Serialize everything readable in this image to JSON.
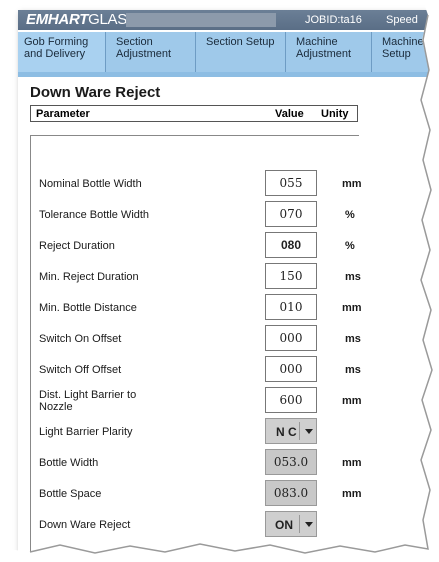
{
  "header": {
    "brand_bold": "EMHART",
    "brand_light": "GLASS",
    "jobid": "JOBID:ta16",
    "speed": "Speed"
  },
  "tabs": [
    {
      "label": "Gob Forming and Delivery"
    },
    {
      "label": "Section Adjustment"
    },
    {
      "label": "Section Setup"
    },
    {
      "label": "Machine Adjustment"
    },
    {
      "label": "Machine Setup"
    }
  ],
  "panel": {
    "title": "Down Ware Reject",
    "col_parameter": "Parameter",
    "col_value": "Value",
    "col_unity": "Unity"
  },
  "params": [
    {
      "label": "Nominal Bottle Width",
      "value": "055",
      "unit": "mm"
    },
    {
      "label": "Tolerance Bottle Width",
      "value": "070",
      "unit": "%"
    },
    {
      "label": "Reject Duration",
      "value": "080",
      "unit": "%"
    },
    {
      "label": "Min. Reject Duration",
      "value": "150",
      "unit": "ms"
    },
    {
      "label": "Min. Bottle Distance",
      "value": "010",
      "unit": "mm"
    },
    {
      "label": "Switch On Offset",
      "value": "000",
      "unit": "ms"
    },
    {
      "label": "Switch Off Offset",
      "value": "000",
      "unit": "ms"
    },
    {
      "label": "Dist. Light Barrier to Nozzle",
      "value": "600",
      "unit": "mm"
    },
    {
      "label": "Light Barrier Plarity",
      "value": "N C",
      "unit": ""
    },
    {
      "label": "Bottle Width",
      "value": "053.0",
      "unit": "mm"
    },
    {
      "label": "Bottle Space",
      "value": "083.0",
      "unit": "mm"
    },
    {
      "label": "Down Ware Reject",
      "value": "ON",
      "unit": ""
    }
  ]
}
